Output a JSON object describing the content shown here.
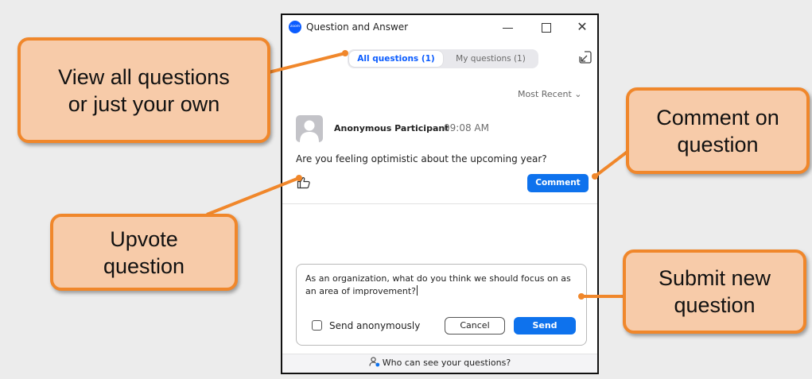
{
  "window": {
    "title": "Question and Answer",
    "logo_text": "zoom",
    "close_glyph": "✕"
  },
  "tabs": [
    {
      "label": "All questions (1)",
      "selected": true
    },
    {
      "label": "My questions (1)",
      "selected": false
    }
  ],
  "sort": {
    "label": "Most Recent ⌄"
  },
  "question": {
    "author": "Anonymous Participant",
    "time": "09:08 AM",
    "text": "Are you feeling optimistic about the upcoming year?",
    "comment_label": "Comment"
  },
  "compose": {
    "value": "As an organization, what do you think we should focus on as an area of improvement?",
    "anonymous_label": "Send anonymously",
    "anonymous_checked": false,
    "cancel_label": "Cancel",
    "send_label": "Send"
  },
  "footer": {
    "text": "Who can see your questions?"
  },
  "callouts": {
    "view": "View all questions\nor just your own",
    "upvote": "Upvote\nquestion",
    "comment": "Comment on\nquestion",
    "submit": "Submit new\nquestion"
  },
  "colors": {
    "accent": "#0e72ed",
    "callout_fill": "#f7cba9",
    "callout_border": "#f0872b"
  },
  "icons": [
    "zoom-logo-icon",
    "minimize-icon",
    "maximize-icon",
    "close-icon",
    "popout-icon",
    "avatar-icon",
    "thumbs-up-icon",
    "privacy-icon"
  ]
}
